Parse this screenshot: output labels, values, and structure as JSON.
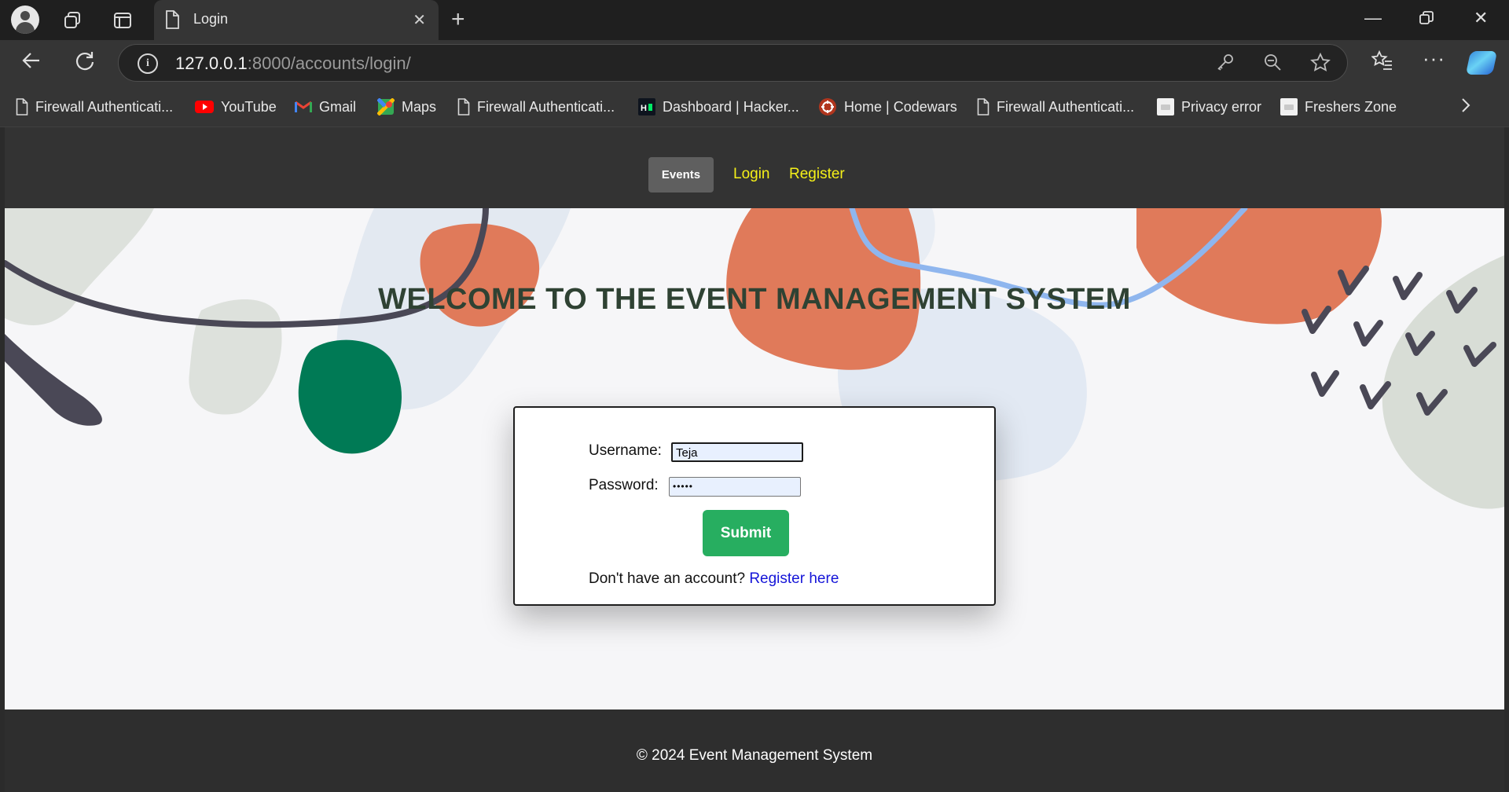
{
  "browser": {
    "tab_title": "Login",
    "url_host": "127.0.0.1",
    "url_rest": ":8000/accounts/login/",
    "bookmarks": [
      {
        "label": "Firewall Authenticati...",
        "icon": "page-icon"
      },
      {
        "label": "YouTube",
        "icon": "youtube-icon"
      },
      {
        "label": "Gmail",
        "icon": "gmail-icon"
      },
      {
        "label": "Maps",
        "icon": "maps-icon"
      },
      {
        "label": "Firewall Authenticati...",
        "icon": "page-icon"
      },
      {
        "label": "Dashboard | Hacker...",
        "icon": "hackerrank-icon"
      },
      {
        "label": "Home | Codewars",
        "icon": "codewars-icon"
      },
      {
        "label": "Firewall Authenticati...",
        "icon": "page-icon"
      },
      {
        "label": "Privacy error",
        "icon": "error-page-icon"
      },
      {
        "label": "Freshers Zone",
        "icon": "error-page-icon"
      }
    ]
  },
  "site_nav": {
    "events": "Events",
    "login": "Login",
    "register": "Register"
  },
  "hero": {
    "heading": "WELCOME TO THE EVENT MANAGEMENT SYSTEM"
  },
  "login_form": {
    "username_label": "Username:",
    "username_value": "Teja",
    "password_label": "Password:",
    "password_value": "•••••",
    "submit_label": "Submit",
    "no_account_text": "Don't have an account?",
    "register_link": "Register here"
  },
  "footer": {
    "text": "© 2024 Event Management System"
  },
  "colors": {
    "accent_green": "#27ae60",
    "nav_link": "#f5f019",
    "heading": "#2f4233",
    "link_blue": "#1515d8"
  }
}
